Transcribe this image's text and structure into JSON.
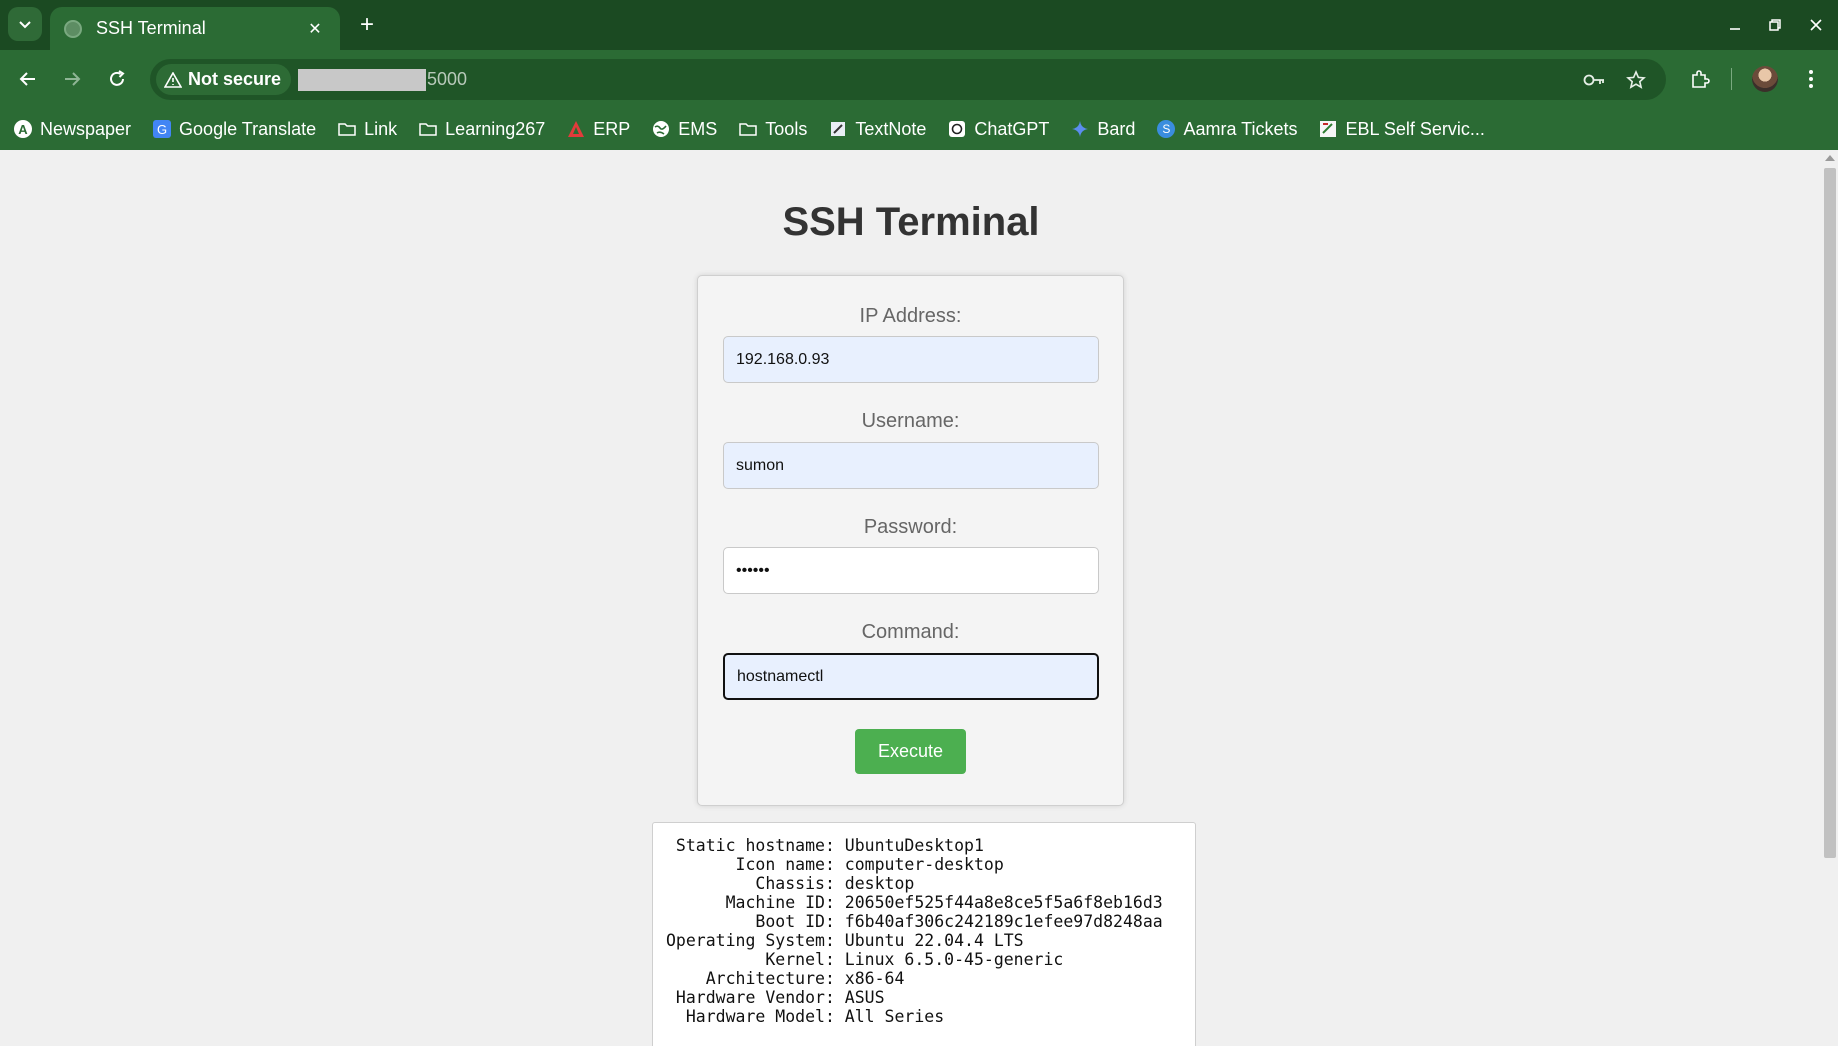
{
  "browser": {
    "tab_title": "SSH Terminal",
    "new_tab": "+",
    "security_label": "Not secure",
    "url_port": "5000",
    "bookmarks": [
      {
        "label": "Newspaper",
        "icon": "newspaper-icon"
      },
      {
        "label": "Google Translate",
        "icon": "google-translate-icon"
      },
      {
        "label": "Link",
        "icon": "folder-icon"
      },
      {
        "label": "Learning267",
        "icon": "folder-icon"
      },
      {
        "label": "ERP",
        "icon": "erp-icon"
      },
      {
        "label": "EMS",
        "icon": "globe-icon"
      },
      {
        "label": "Tools",
        "icon": "folder-icon"
      },
      {
        "label": "TextNote",
        "icon": "textnote-icon"
      },
      {
        "label": "ChatGPT",
        "icon": "chatgpt-icon"
      },
      {
        "label": "Bard",
        "icon": "bard-icon"
      },
      {
        "label": "Aamra Tickets",
        "icon": "aamra-icon"
      },
      {
        "label": "EBL Self Servic...",
        "icon": "ebl-icon"
      }
    ]
  },
  "page": {
    "title": "SSH Terminal",
    "form": {
      "ip_label": "IP Address:",
      "ip_value": "192.168.0.93",
      "username_label": "Username:",
      "username_value": "sumon",
      "password_label": "Password:",
      "password_value": "••••••",
      "command_label": "Command:",
      "command_value": "hostnamectl",
      "execute_label": "Execute"
    },
    "output": " Static hostname: UbuntuDesktop1\n       Icon name: computer-desktop\n         Chassis: desktop\n      Machine ID: 20650ef525f44a8e8ce5f5a6f8eb16d3\n         Boot ID: f6b40af306c242189c1efee97d8248aa\nOperating System: Ubuntu 22.04.4 LTS\n          Kernel: Linux 6.5.0-45-generic\n    Architecture: x86-64\n Hardware Vendor: ASUS\n  Hardware Model: All Series"
  },
  "colors": {
    "chrome_dark": "#1b4a22",
    "chrome": "#2b6b34",
    "execute_button": "#4caf50",
    "autofill_input": "#e8f0fe"
  }
}
